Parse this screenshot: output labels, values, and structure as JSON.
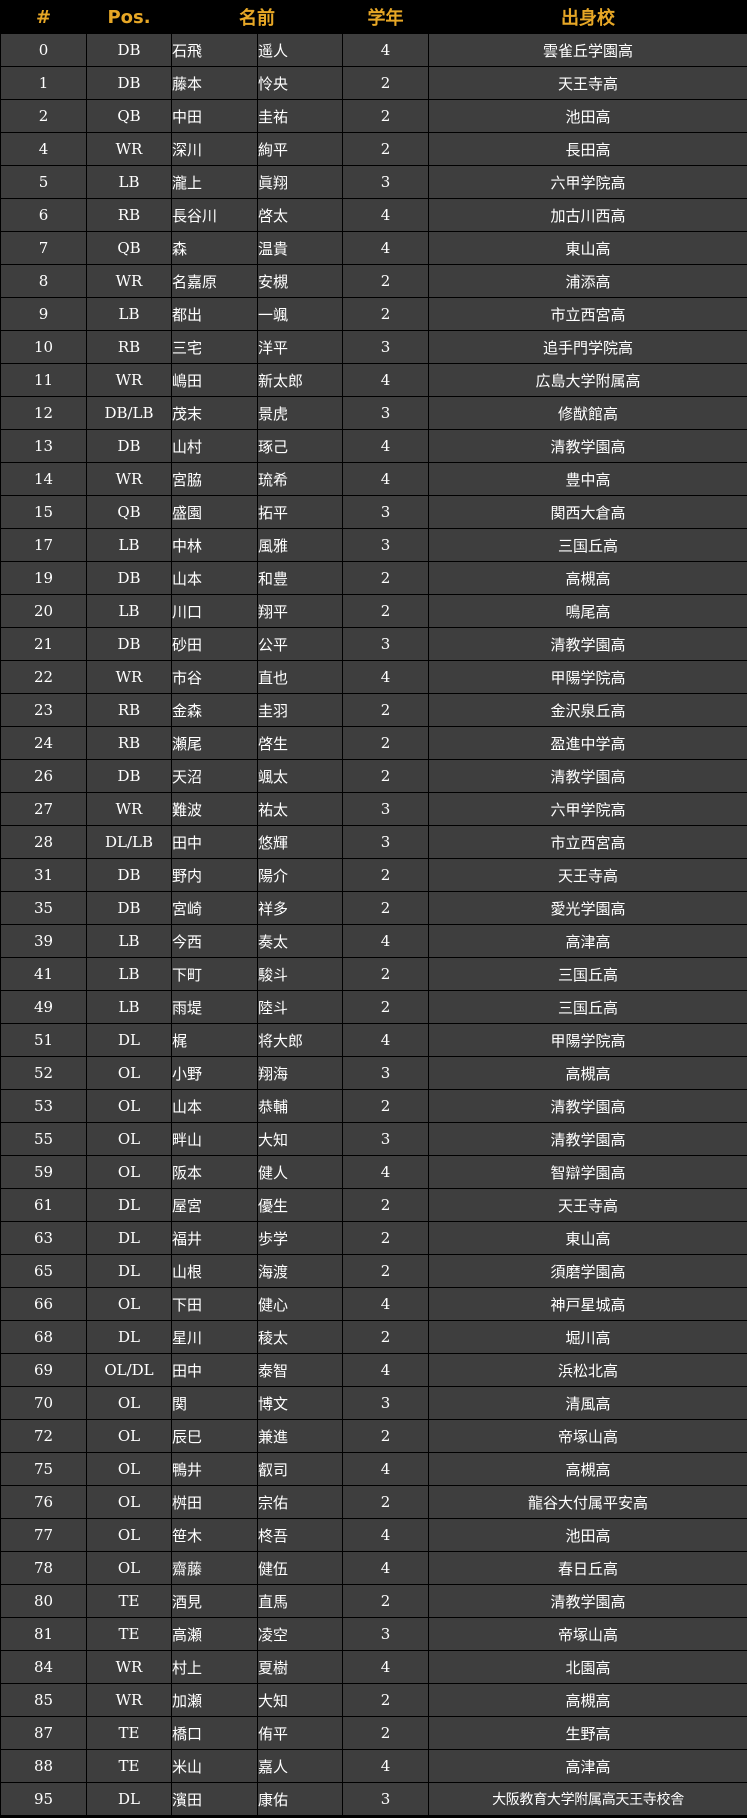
{
  "header": {
    "number": "#",
    "position": "Pos.",
    "name": "名前",
    "grade": "学年",
    "school": "出身校"
  },
  "roster": [
    {
      "number": "0",
      "position": "DB",
      "last": "石飛",
      "first": "遥人",
      "grade": "4",
      "school": "雲雀丘学園高"
    },
    {
      "number": "1",
      "position": "DB",
      "last": "藤本",
      "first": "怜央",
      "grade": "2",
      "school": "天王寺高"
    },
    {
      "number": "2",
      "position": "QB",
      "last": "中田",
      "first": "圭祐",
      "grade": "2",
      "school": "池田高"
    },
    {
      "number": "4",
      "position": "WR",
      "last": "深川",
      "first": "絢平",
      "grade": "2",
      "school": "長田高"
    },
    {
      "number": "5",
      "position": "LB",
      "last": "瀧上",
      "first": "眞翔",
      "grade": "3",
      "school": "六甲学院高"
    },
    {
      "number": "6",
      "position": "RB",
      "last": "長谷川",
      "first": "啓太",
      "grade": "4",
      "school": "加古川西高"
    },
    {
      "number": "7",
      "position": "QB",
      "last": "森",
      "first": "温貴",
      "grade": "4",
      "school": "東山高"
    },
    {
      "number": "8",
      "position": "WR",
      "last": "名嘉原",
      "first": "安槻",
      "grade": "2",
      "school": "浦添高"
    },
    {
      "number": "9",
      "position": "LB",
      "last": "都出",
      "first": "一颯",
      "grade": "2",
      "school": "市立西宮高"
    },
    {
      "number": "10",
      "position": "RB",
      "last": "三宅",
      "first": "洋平",
      "grade": "3",
      "school": "追手門学院高"
    },
    {
      "number": "11",
      "position": "WR",
      "last": "嶋田",
      "first": "新太郎",
      "grade": "4",
      "school": "広島大学附属高"
    },
    {
      "number": "12",
      "position": "DB/LB",
      "last": "茂末",
      "first": "景虎",
      "grade": "3",
      "school": "修猷館高"
    },
    {
      "number": "13",
      "position": "DB",
      "last": "山村",
      "first": "琢己",
      "grade": "4",
      "school": "清教学園高"
    },
    {
      "number": "14",
      "position": "WR",
      "last": "宮脇",
      "first": "琉希",
      "grade": "4",
      "school": "豊中高"
    },
    {
      "number": "15",
      "position": "QB",
      "last": "盛園",
      "first": "拓平",
      "grade": "3",
      "school": "関西大倉高"
    },
    {
      "number": "17",
      "position": "LB",
      "last": "中林",
      "first": "風雅",
      "grade": "3",
      "school": "三国丘高"
    },
    {
      "number": "19",
      "position": "DB",
      "last": "山本",
      "first": "和豊",
      "grade": "2",
      "school": "高槻高"
    },
    {
      "number": "20",
      "position": "LB",
      "last": "川口",
      "first": "翔平",
      "grade": "2",
      "school": "鳴尾高"
    },
    {
      "number": "21",
      "position": "DB",
      "last": "砂田",
      "first": "公平",
      "grade": "3",
      "school": "清教学園高"
    },
    {
      "number": "22",
      "position": "WR",
      "last": "市谷",
      "first": "直也",
      "grade": "4",
      "school": "甲陽学院高"
    },
    {
      "number": "23",
      "position": "RB",
      "last": "金森",
      "first": "圭羽",
      "grade": "2",
      "school": "金沢泉丘高"
    },
    {
      "number": "24",
      "position": "RB",
      "last": "瀬尾",
      "first": "啓生",
      "grade": "2",
      "school": "盈進中学高"
    },
    {
      "number": "26",
      "position": "DB",
      "last": "天沼",
      "first": "颯太",
      "grade": "2",
      "school": "清教学園高"
    },
    {
      "number": "27",
      "position": "WR",
      "last": "難波",
      "first": "祐太",
      "grade": "3",
      "school": "六甲学院高"
    },
    {
      "number": "28",
      "position": "DL/LB",
      "last": "田中",
      "first": "悠輝",
      "grade": "3",
      "school": "市立西宮高"
    },
    {
      "number": "31",
      "position": "DB",
      "last": "野内",
      "first": "陽介",
      "grade": "2",
      "school": "天王寺高"
    },
    {
      "number": "35",
      "position": "DB",
      "last": "宮崎",
      "first": "祥多",
      "grade": "2",
      "school": "愛光学園高"
    },
    {
      "number": "39",
      "position": "LB",
      "last": "今西",
      "first": "奏太",
      "grade": "4",
      "school": "高津高"
    },
    {
      "number": "41",
      "position": "LB",
      "last": "下町",
      "first": "駿斗",
      "grade": "2",
      "school": "三国丘高"
    },
    {
      "number": "49",
      "position": "LB",
      "last": "雨堤",
      "first": "陸斗",
      "grade": "2",
      "school": "三国丘高"
    },
    {
      "number": "51",
      "position": "DL",
      "last": "梶",
      "first": "将大郎",
      "grade": "4",
      "school": "甲陽学院高"
    },
    {
      "number": "52",
      "position": "OL",
      "last": "小野",
      "first": "翔海",
      "grade": "3",
      "school": "高槻高"
    },
    {
      "number": "53",
      "position": "OL",
      "last": "山本",
      "first": "恭輔",
      "grade": "2",
      "school": "清教学園高"
    },
    {
      "number": "55",
      "position": "OL",
      "last": "畔山",
      "first": "大知",
      "grade": "3",
      "school": "清教学園高"
    },
    {
      "number": "59",
      "position": "OL",
      "last": "阪本",
      "first": "健人",
      "grade": "4",
      "school": "智辯学園高"
    },
    {
      "number": "61",
      "position": "DL",
      "last": "屋宮",
      "first": "優生",
      "grade": "2",
      "school": "天王寺高"
    },
    {
      "number": "63",
      "position": "DL",
      "last": "福井",
      "first": "歩学",
      "grade": "2",
      "school": "東山高"
    },
    {
      "number": "65",
      "position": "DL",
      "last": "山根",
      "first": "海渡",
      "grade": "2",
      "school": "須磨学園高"
    },
    {
      "number": "66",
      "position": "OL",
      "last": "下田",
      "first": "健心",
      "grade": "4",
      "school": "神戸星城高"
    },
    {
      "number": "68",
      "position": "DL",
      "last": "星川",
      "first": "稜太",
      "grade": "2",
      "school": "堀川高"
    },
    {
      "number": "69",
      "position": "OL/DL",
      "last": "田中",
      "first": "泰智",
      "grade": "4",
      "school": "浜松北高"
    },
    {
      "number": "70",
      "position": "OL",
      "last": "関",
      "first": "博文",
      "grade": "3",
      "school": "清風高"
    },
    {
      "number": "72",
      "position": "OL",
      "last": "辰巳",
      "first": "兼進",
      "grade": "2",
      "school": "帝塚山高"
    },
    {
      "number": "75",
      "position": "OL",
      "last": "鴨井",
      "first": "叡司",
      "grade": "4",
      "school": "高槻高"
    },
    {
      "number": "76",
      "position": "OL",
      "last": "桝田",
      "first": "宗佑",
      "grade": "2",
      "school": "龍谷大付属平安高"
    },
    {
      "number": "77",
      "position": "OL",
      "last": "笹木",
      "first": "柊吾",
      "grade": "4",
      "school": "池田高"
    },
    {
      "number": "78",
      "position": "OL",
      "last": "齋藤",
      "first": "健伍",
      "grade": "4",
      "school": "春日丘高"
    },
    {
      "number": "80",
      "position": "TE",
      "last": "酒見",
      "first": "直馬",
      "grade": "2",
      "school": "清教学園高"
    },
    {
      "number": "81",
      "position": "TE",
      "last": "高瀬",
      "first": "凌空",
      "grade": "3",
      "school": "帝塚山高"
    },
    {
      "number": "84",
      "position": "WR",
      "last": "村上",
      "first": "夏樹",
      "grade": "4",
      "school": "北園高"
    },
    {
      "number": "85",
      "position": "WR",
      "last": "加瀬",
      "first": "大知",
      "grade": "2",
      "school": "高槻高"
    },
    {
      "number": "87",
      "position": "TE",
      "last": "橋口",
      "first": "侑平",
      "grade": "2",
      "school": "生野高"
    },
    {
      "number": "88",
      "position": "TE",
      "last": "米山",
      "first": "嘉人",
      "grade": "4",
      "school": "高津高"
    },
    {
      "number": "95",
      "position": "DL",
      "last": "濱田",
      "first": "康佑",
      "grade": "3",
      "school": "大阪教育大学附属高天王寺校舎"
    }
  ]
}
